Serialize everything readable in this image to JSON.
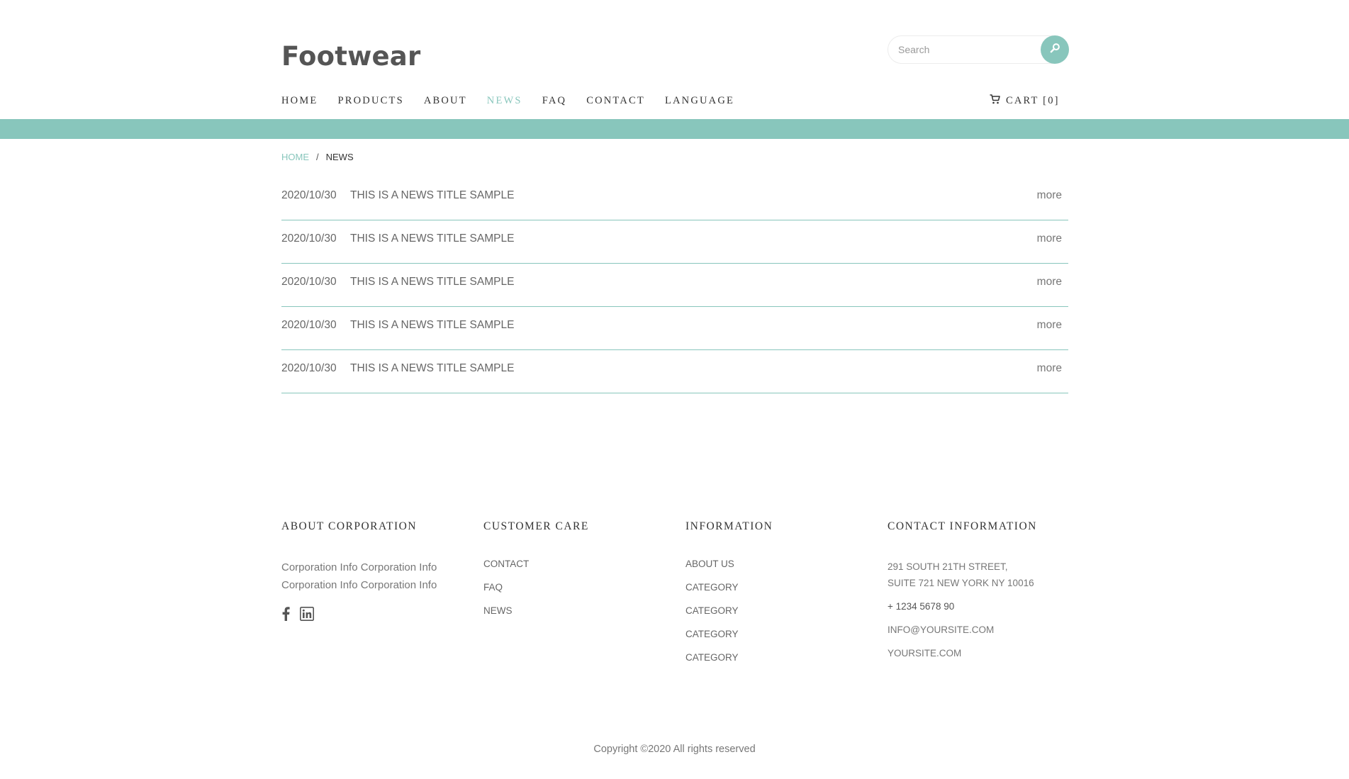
{
  "header": {
    "logo": "Footwear",
    "search_placeholder": "Search"
  },
  "nav": {
    "items": [
      "HOME",
      "PRODUCTS",
      "ABOUT",
      "NEWS",
      "FAQ",
      "CONTACT",
      "LANGUAGE"
    ],
    "active": "NEWS",
    "cart_label": "CART [0]"
  },
  "colors": {
    "accent": "#88c6bc"
  },
  "breadcrumb": {
    "home": "HOME",
    "separator": "/",
    "current": "NEWS"
  },
  "news": [
    {
      "date": "2020/10/30",
      "title": "THIS IS A NEWS TITLE SAMPLE",
      "more": "more"
    },
    {
      "date": "2020/10/30",
      "title": "THIS IS A NEWS TITLE SAMPLE",
      "more": "more"
    },
    {
      "date": "2020/10/30",
      "title": "THIS IS A NEWS TITLE SAMPLE",
      "more": "more"
    },
    {
      "date": "2020/10/30",
      "title": "THIS IS A NEWS TITLE SAMPLE",
      "more": "more"
    },
    {
      "date": "2020/10/30",
      "title": "THIS IS A NEWS TITLE SAMPLE",
      "more": "more"
    }
  ],
  "footer": {
    "about": {
      "heading": "ABOUT CORPORATION",
      "line1": "Corporation Info Corporation Info",
      "line2": "Corporation Info Corporation Info",
      "social_icons": [
        "facebook-icon",
        "linkedin-icon"
      ]
    },
    "customer_care": {
      "heading": "CUSTOMER CARE",
      "links": [
        "CONTACT",
        "FAQ",
        "NEWS"
      ]
    },
    "information": {
      "heading": "INFORMATION",
      "links": [
        "ABOUT US",
        "CATEGORY",
        "CATEGORY",
        "CATEGORY",
        "CATEGORY"
      ]
    },
    "contact": {
      "heading": "CONTACT INFORMATION",
      "address1": "291 SOUTH 21TH STREET,",
      "address2": "SUITE 721 NEW YORK NY 10016",
      "phone": "+ 1234 5678 90",
      "email": "INFO@YOURSITE.COM",
      "website": "YOURSITE.COM"
    },
    "copyright": "Copyright ©2020 All rights reserved"
  }
}
